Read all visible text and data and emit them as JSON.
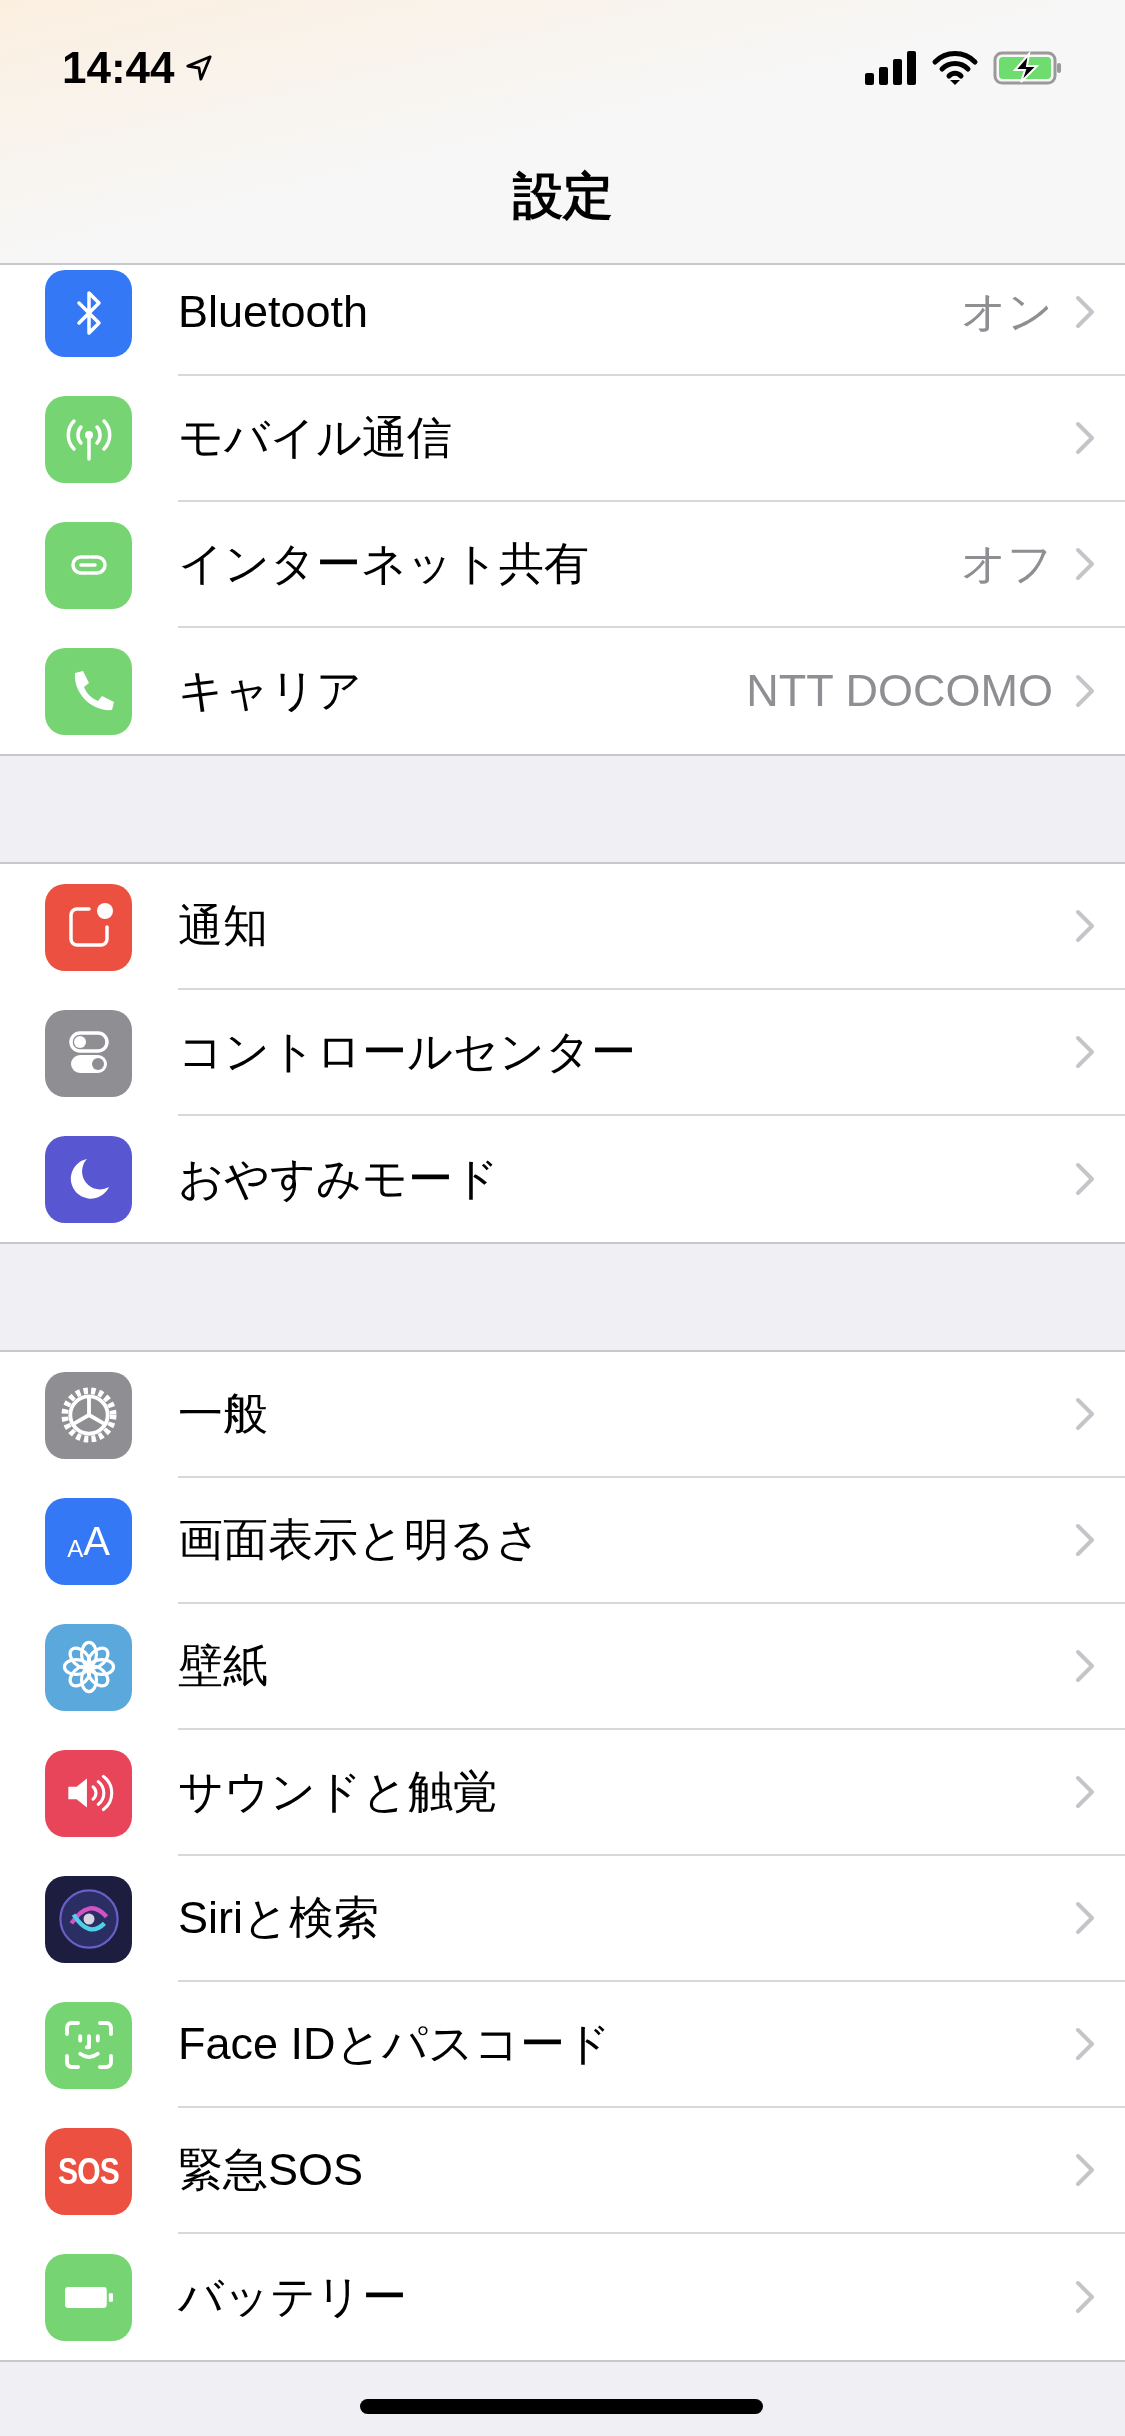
{
  "status_bar": {
    "time": "14:44",
    "location_on": true,
    "charging": true
  },
  "nav": {
    "title": "設定"
  },
  "groups": [
    {
      "items": [
        {
          "kind": "bluetooth",
          "color": "#3478f6",
          "label": "Bluetooth",
          "value": "オン"
        },
        {
          "kind": "antenna",
          "color": "#76d572",
          "label": "モバイル通信"
        },
        {
          "kind": "link",
          "color": "#76d572",
          "label": "インターネット共有",
          "value": "オフ"
        },
        {
          "kind": "phone",
          "color": "#76d572",
          "label": "キャリア",
          "value": "NTT DOCOMO"
        }
      ]
    },
    {
      "items": [
        {
          "kind": "notification",
          "color": "#ec5041",
          "label": "通知"
        },
        {
          "kind": "toggles",
          "color": "#8e8e93",
          "label": "コントロールセンター"
        },
        {
          "kind": "moon",
          "color": "#5856d0",
          "label": "おやすみモード"
        }
      ]
    },
    {
      "items": [
        {
          "kind": "gear",
          "color": "#8e8e93",
          "label": "一般"
        },
        {
          "kind": "letters",
          "color": "#3478f6",
          "label": "画面表示と明るさ",
          "icon_text": [
            "A",
            "A"
          ]
        },
        {
          "kind": "flower",
          "color": "#5aa8dc",
          "label": "壁紙"
        },
        {
          "kind": "speaker",
          "color": "#e9455a",
          "label": "サウンドと触覚"
        },
        {
          "kind": "orb",
          "color": "#1d1d3f",
          "label": "Siriと検索"
        },
        {
          "kind": "face",
          "color": "#76d572",
          "label": "Face IDとパスコード"
        },
        {
          "kind": "sos",
          "color": "#ec5041",
          "label": "緊急SOS",
          "icon_text": [
            "SOS"
          ]
        },
        {
          "kind": "battery",
          "color": "#76d572",
          "label": "バッテリー"
        }
      ]
    }
  ]
}
